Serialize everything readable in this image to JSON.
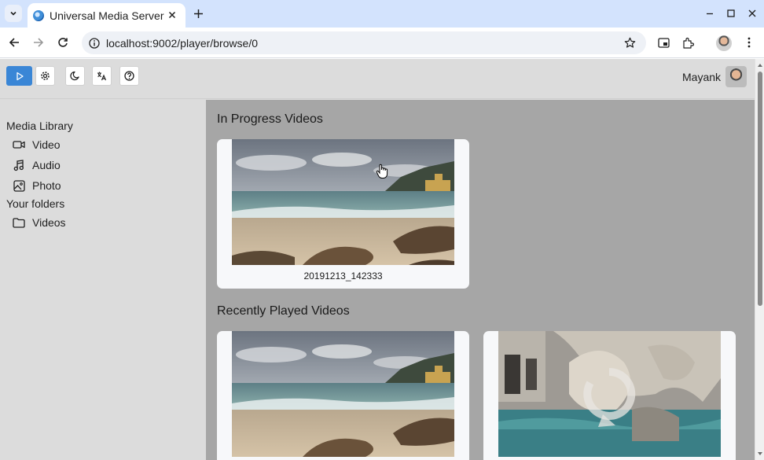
{
  "browser": {
    "tab_title": "Universal Media Server",
    "url": "localhost:9002/player/browse/0",
    "icons": [
      "tab-search-icon",
      "favicon-icon",
      "close-icon",
      "new-tab-icon",
      "minimize-icon",
      "maximize-icon",
      "window-close-icon",
      "back-icon",
      "forward-icon",
      "reload-icon",
      "site-info-icon",
      "bookmark-star-icon",
      "picture-in-picture-icon",
      "extensions-icon",
      "profile-avatar",
      "more-menu-icon"
    ]
  },
  "header": {
    "buttons": [
      {
        "name": "player-button",
        "icon": "play-icon",
        "active": true
      },
      {
        "name": "settings-button",
        "icon": "gear-icon"
      },
      {
        "name": "dark-mode-button",
        "icon": "moon-icon"
      },
      {
        "name": "language-button",
        "icon": "translate-icon"
      },
      {
        "name": "help-button",
        "icon": "help-icon"
      }
    ],
    "user_name": "Mayank"
  },
  "sidebar": {
    "media_library_heading": "Media Library",
    "media_items": [
      {
        "label": "Video",
        "icon": "video-camera-icon"
      },
      {
        "label": "Audio",
        "icon": "music-note-icon"
      },
      {
        "label": "Photo",
        "icon": "photo-icon"
      }
    ],
    "folders_heading": "Your folders",
    "folder_items": [
      {
        "label": "Videos",
        "icon": "folder-icon"
      }
    ]
  },
  "main": {
    "in_progress_title": "In Progress Videos",
    "in_progress": [
      {
        "title": "20191213_142333",
        "thumbnail": "beach-thumbnail"
      }
    ],
    "recently_played_title": "Recently Played Videos",
    "recently_played": [
      {
        "title": "",
        "thumbnail": "beach-thumbnail"
      },
      {
        "title": "",
        "thumbnail": "fountain-thumbnail-loading"
      }
    ]
  },
  "colors": {
    "accent": "#3a86d6",
    "tabbar": "#d3e3fd",
    "sidebar_bg": "#dcdcdc",
    "main_bg": "#a6a6a6",
    "card_bg": "#f7f8fa"
  }
}
